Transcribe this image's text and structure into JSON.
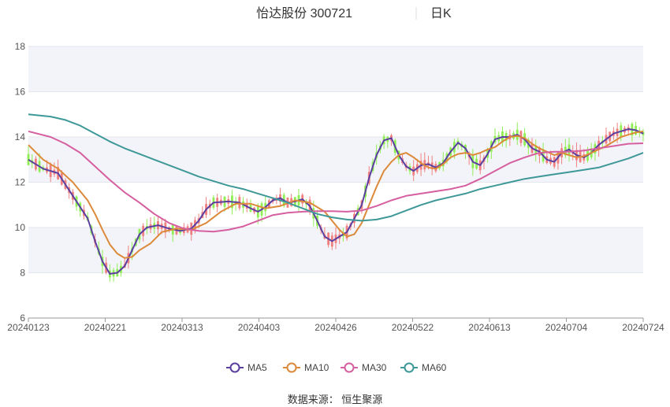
{
  "chart_data": {
    "type": "candlestick",
    "title": "怡达股份 300721",
    "period": "日K",
    "xlabel": "",
    "ylabel": "",
    "ylim": [
      6,
      18
    ],
    "yticks": [
      6,
      8,
      10,
      12,
      14,
      16,
      18
    ],
    "xtick_labels": [
      "20240123",
      "20240221",
      "20240313",
      "20240403",
      "20240426",
      "20240522",
      "20240613",
      "20240704",
      "20240724"
    ],
    "grid": true,
    "legend_position": "bottom-center",
    "colors": {
      "up": "#f08080",
      "down": "#90ee55",
      "MA5": "#5b3fa0",
      "MA10": "#dc8a3a",
      "MA30": "#d65fa0",
      "MA60": "#3f9898"
    },
    "series": [
      {
        "name": "MA5",
        "points": [
          [
            0,
            13.0
          ],
          [
            4,
            12.6
          ],
          [
            8,
            12.4
          ],
          [
            12,
            11.4
          ],
          [
            16,
            10.4
          ],
          [
            18,
            9.4
          ],
          [
            20,
            8.5
          ],
          [
            22,
            7.95
          ],
          [
            24,
            8.0
          ],
          [
            26,
            8.3
          ],
          [
            28,
            9.0
          ],
          [
            30,
            9.7
          ],
          [
            32,
            10.0
          ],
          [
            35,
            10.1
          ],
          [
            38,
            9.95
          ],
          [
            41,
            9.85
          ],
          [
            44,
            9.95
          ],
          [
            46,
            10.3
          ],
          [
            48,
            10.8
          ],
          [
            50,
            11.1
          ],
          [
            54,
            11.15
          ],
          [
            57,
            11.1
          ],
          [
            60,
            10.85
          ],
          [
            62,
            10.7
          ],
          [
            64,
            10.9
          ],
          [
            66,
            11.2
          ],
          [
            68,
            11.3
          ],
          [
            70,
            11.1
          ],
          [
            72,
            11.15
          ],
          [
            74,
            11.25
          ],
          [
            76,
            10.95
          ],
          [
            78,
            10.3
          ],
          [
            80,
            9.6
          ],
          [
            82,
            9.4
          ],
          [
            84,
            9.6
          ],
          [
            86,
            9.8
          ],
          [
            88,
            10.4
          ],
          [
            90,
            11.0
          ],
          [
            92,
            12.2
          ],
          [
            94,
            13.2
          ],
          [
            96,
            13.85
          ],
          [
            98,
            13.95
          ],
          [
            100,
            13.2
          ],
          [
            102,
            12.7
          ],
          [
            104,
            12.5
          ],
          [
            106,
            12.75
          ],
          [
            108,
            12.8
          ],
          [
            110,
            12.65
          ],
          [
            112,
            12.85
          ],
          [
            114,
            13.35
          ],
          [
            116,
            13.75
          ],
          [
            118,
            13.5
          ],
          [
            120,
            12.9
          ],
          [
            122,
            12.75
          ],
          [
            124,
            13.25
          ],
          [
            126,
            13.9
          ],
          [
            128,
            14.0
          ],
          [
            130,
            14.0
          ],
          [
            132,
            14.1
          ],
          [
            134,
            13.9
          ],
          [
            136,
            13.5
          ],
          [
            138,
            13.35
          ],
          [
            140,
            13.0
          ],
          [
            142,
            12.9
          ],
          [
            144,
            13.3
          ],
          [
            146,
            13.45
          ],
          [
            148,
            13.2
          ],
          [
            150,
            13.1
          ],
          [
            152,
            13.3
          ],
          [
            154,
            13.65
          ],
          [
            156,
            13.9
          ],
          [
            158,
            14.15
          ],
          [
            160,
            14.25
          ],
          [
            162,
            14.35
          ],
          [
            164,
            14.3
          ],
          [
            166,
            14.15
          ]
        ]
      },
      {
        "name": "MA10",
        "points": [
          [
            0,
            13.65
          ],
          [
            4,
            13.0
          ],
          [
            8,
            12.6
          ],
          [
            12,
            12.0
          ],
          [
            16,
            11.2
          ],
          [
            18,
            10.6
          ],
          [
            20,
            9.9
          ],
          [
            22,
            9.25
          ],
          [
            24,
            8.85
          ],
          [
            26,
            8.65
          ],
          [
            28,
            8.7
          ],
          [
            30,
            9.0
          ],
          [
            33,
            9.3
          ],
          [
            36,
            9.8
          ],
          [
            40,
            9.95
          ],
          [
            44,
            9.9
          ],
          [
            48,
            10.2
          ],
          [
            52,
            10.7
          ],
          [
            56,
            11.05
          ],
          [
            60,
            11.05
          ],
          [
            64,
            10.85
          ],
          [
            68,
            10.95
          ],
          [
            72,
            11.2
          ],
          [
            76,
            11.1
          ],
          [
            80,
            10.7
          ],
          [
            84,
            9.9
          ],
          [
            86,
            9.6
          ],
          [
            88,
            9.7
          ],
          [
            90,
            10.2
          ],
          [
            92,
            11.0
          ],
          [
            94,
            11.8
          ],
          [
            96,
            12.5
          ],
          [
            98,
            12.9
          ],
          [
            100,
            13.2
          ],
          [
            102,
            13.3
          ],
          [
            104,
            13.1
          ],
          [
            106,
            12.85
          ],
          [
            108,
            12.65
          ],
          [
            110,
            12.6
          ],
          [
            112,
            12.8
          ],
          [
            114,
            13.1
          ],
          [
            116,
            13.25
          ],
          [
            118,
            13.3
          ],
          [
            120,
            13.2
          ],
          [
            122,
            13.3
          ],
          [
            124,
            13.45
          ],
          [
            126,
            13.55
          ],
          [
            128,
            13.8
          ],
          [
            130,
            14.0
          ],
          [
            132,
            14.05
          ],
          [
            134,
            13.95
          ],
          [
            136,
            13.7
          ],
          [
            138,
            13.5
          ],
          [
            140,
            13.35
          ],
          [
            142,
            13.2
          ],
          [
            144,
            13.3
          ],
          [
            146,
            13.2
          ],
          [
            148,
            13.1
          ],
          [
            150,
            13.15
          ],
          [
            152,
            13.3
          ],
          [
            154,
            13.45
          ],
          [
            156,
            13.6
          ],
          [
            158,
            13.8
          ],
          [
            160,
            14.0
          ],
          [
            162,
            14.1
          ],
          [
            164,
            14.2
          ],
          [
            166,
            14.25
          ]
        ]
      },
      {
        "name": "MA30",
        "points": [
          [
            0,
            14.25
          ],
          [
            6,
            14.0
          ],
          [
            10,
            13.7
          ],
          [
            14,
            13.3
          ],
          [
            18,
            12.7
          ],
          [
            22,
            12.1
          ],
          [
            26,
            11.55
          ],
          [
            30,
            11.1
          ],
          [
            34,
            10.6
          ],
          [
            38,
            10.2
          ],
          [
            42,
            9.95
          ],
          [
            46,
            9.85
          ],
          [
            50,
            9.82
          ],
          [
            54,
            9.9
          ],
          [
            58,
            10.05
          ],
          [
            62,
            10.3
          ],
          [
            66,
            10.55
          ],
          [
            70,
            10.65
          ],
          [
            74,
            10.7
          ],
          [
            78,
            10.72
          ],
          [
            82,
            10.72
          ],
          [
            86,
            10.7
          ],
          [
            90,
            10.75
          ],
          [
            94,
            10.95
          ],
          [
            98,
            11.2
          ],
          [
            102,
            11.4
          ],
          [
            106,
            11.5
          ],
          [
            110,
            11.6
          ],
          [
            114,
            11.7
          ],
          [
            118,
            11.85
          ],
          [
            122,
            12.15
          ],
          [
            126,
            12.5
          ],
          [
            130,
            12.85
          ],
          [
            134,
            13.1
          ],
          [
            138,
            13.3
          ],
          [
            142,
            13.35
          ],
          [
            146,
            13.35
          ],
          [
            150,
            13.4
          ],
          [
            154,
            13.5
          ],
          [
            158,
            13.6
          ],
          [
            162,
            13.7
          ],
          [
            166,
            13.72
          ]
        ]
      },
      {
        "name": "MA60",
        "points": [
          [
            0,
            15.0
          ],
          [
            6,
            14.9
          ],
          [
            10,
            14.75
          ],
          [
            14,
            14.5
          ],
          [
            18,
            14.15
          ],
          [
            22,
            13.8
          ],
          [
            26,
            13.5
          ],
          [
            30,
            13.25
          ],
          [
            34,
            13.0
          ],
          [
            38,
            12.75
          ],
          [
            42,
            12.5
          ],
          [
            46,
            12.25
          ],
          [
            50,
            12.05
          ],
          [
            54,
            11.85
          ],
          [
            58,
            11.7
          ],
          [
            62,
            11.5
          ],
          [
            66,
            11.3
          ],
          [
            70,
            11.1
          ],
          [
            74,
            10.85
          ],
          [
            78,
            10.6
          ],
          [
            82,
            10.45
          ],
          [
            86,
            10.35
          ],
          [
            90,
            10.3
          ],
          [
            94,
            10.35
          ],
          [
            98,
            10.5
          ],
          [
            102,
            10.75
          ],
          [
            106,
            11.0
          ],
          [
            110,
            11.2
          ],
          [
            114,
            11.35
          ],
          [
            118,
            11.5
          ],
          [
            122,
            11.7
          ],
          [
            126,
            11.85
          ],
          [
            130,
            12.0
          ],
          [
            134,
            12.15
          ],
          [
            138,
            12.25
          ],
          [
            142,
            12.35
          ],
          [
            146,
            12.45
          ],
          [
            150,
            12.55
          ],
          [
            154,
            12.65
          ],
          [
            158,
            12.85
          ],
          [
            162,
            13.05
          ],
          [
            166,
            13.3
          ]
        ]
      }
    ],
    "source": "数据来源：   恒生聚源"
  }
}
